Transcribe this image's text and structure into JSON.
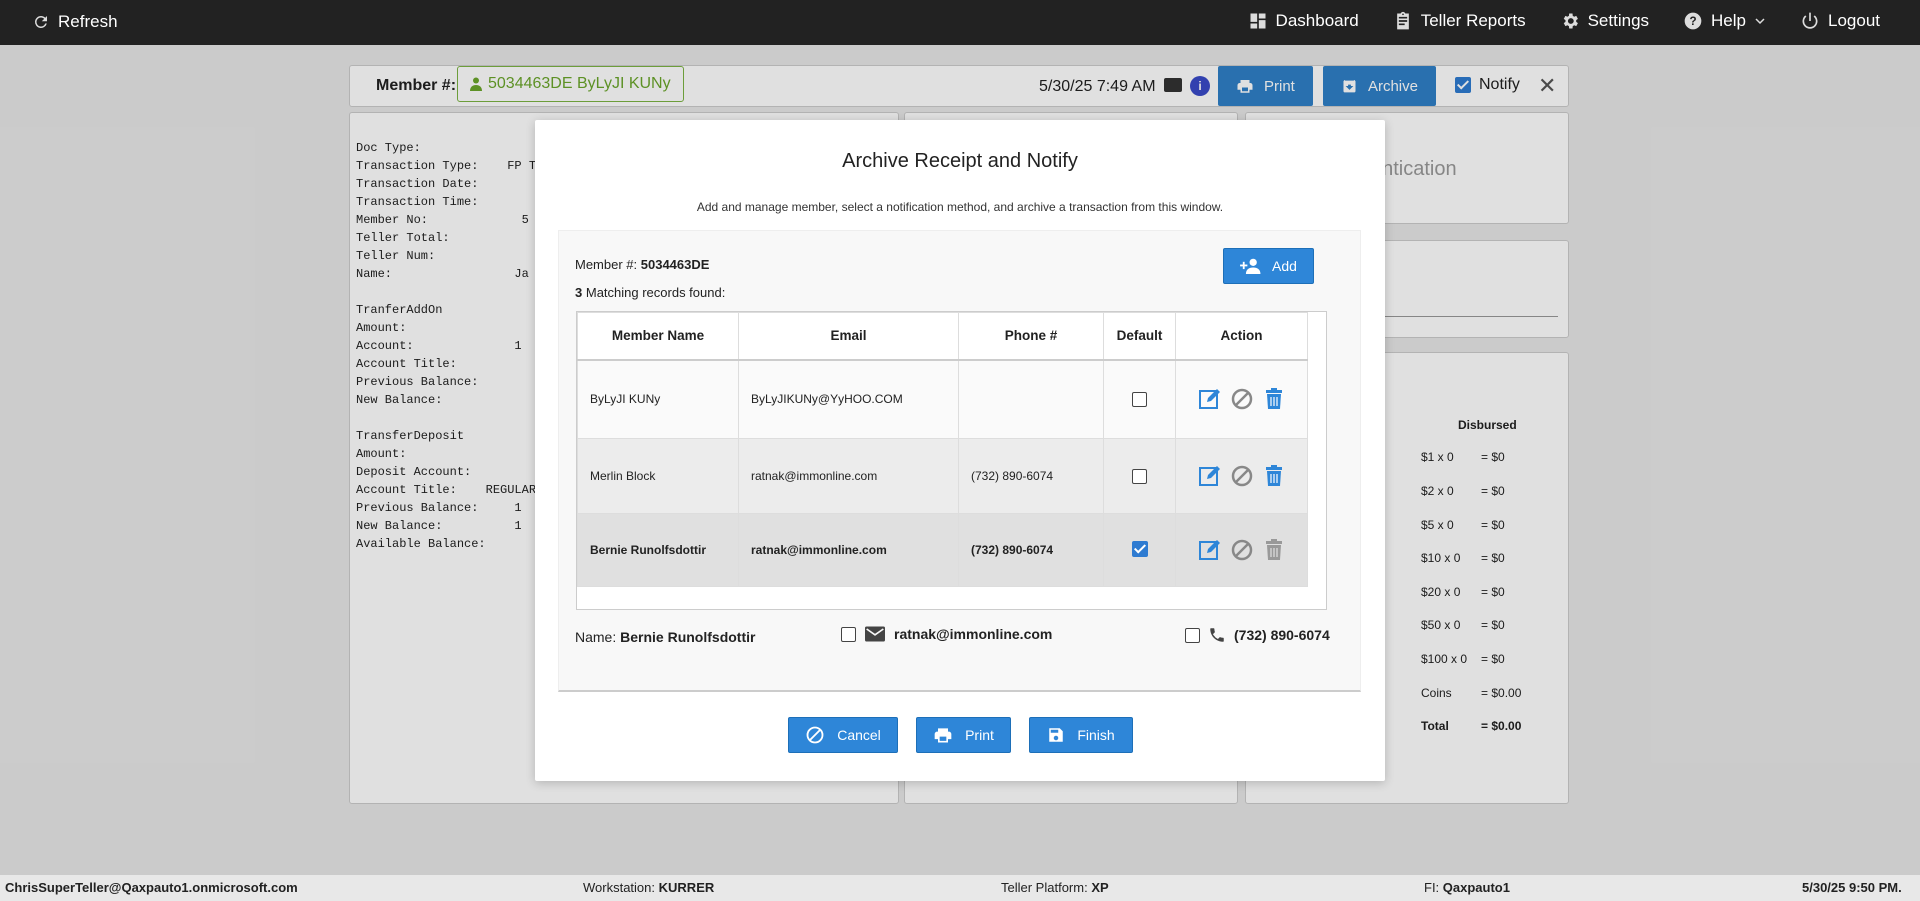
{
  "topbar": {
    "refresh": "Refresh",
    "dashboard": "Dashboard",
    "teller_reports": "Teller Reports",
    "settings": "Settings",
    "help": "Help",
    "logout": "Logout"
  },
  "header": {
    "member_label": "Member #:",
    "member_value": "5034463DE ByLyJI KUNy",
    "datetime": "5/30/25 7:49 AM",
    "print": "Print",
    "archive": "Archive",
    "notify": "Notify"
  },
  "receipt_text": "Doc Type:\nTransaction Type:    FP TRA\nTransaction Date:\nTransaction Time:\nMember No:             5\nTeller Total:\nTeller Num:\nName:                 Ja\n\nTranferAddOn\nAmount:\nAccount:              1\nAccount Title:\nPrevious Balance:\nNew Balance:\n\nTransferDeposit\nAmount:\nDeposit Account:\nAccount Title:    REGULAR\nPrevious Balance:     1\nNew Balance:          1\nAvailable Balance:",
  "right_panel": {
    "title": "entication",
    "disbursed_label": "Disbursed",
    "rows": [
      {
        "label": "$1 x 0",
        "value": "= $0"
      },
      {
        "label": "$2 x 0",
        "value": "= $0"
      },
      {
        "label": "$5 x 0",
        "value": "= $0"
      },
      {
        "label": "$10 x 0",
        "value": "= $0"
      },
      {
        "label": "$20 x 0",
        "value": "= $0"
      },
      {
        "label": "$50 x 0",
        "value": "= $0"
      },
      {
        "label": "$100 x 0",
        "value": "= $0"
      },
      {
        "label": "Coins",
        "value": "= $0.00"
      },
      {
        "label": "Total",
        "value": "= $0.00"
      }
    ]
  },
  "modal": {
    "title": "Archive Receipt and Notify",
    "subtitle": "Add and manage member, select a notification method, and archive a transaction from this window.",
    "member_label": "Member #:",
    "member_value": "5034463DE",
    "match_count": "3",
    "match_text": "Matching records found:",
    "add": "Add",
    "columns": [
      "Member Name",
      "Email",
      "Phone #",
      "Default",
      "Action"
    ],
    "rows": [
      {
        "name": "ByLyJI KUNy",
        "email": "ByLyJIKUNy@YyHOO.COM",
        "phone": "",
        "default": false
      },
      {
        "name": "Merlin Block",
        "email": "ratnak@immonline.com",
        "phone": "(732) 890-6074",
        "default": false
      },
      {
        "name": "Bernie Runolfsdottir",
        "email": "ratnak@immonline.com",
        "phone": "(732) 890-6074",
        "default": true
      }
    ],
    "selected": {
      "name_label": "Name:",
      "name": "Bernie Runolfsdottir",
      "email": "ratnak@immonline.com",
      "phone": "(732) 890-6074"
    },
    "cancel": "Cancel",
    "print": "Print",
    "finish": "Finish"
  },
  "footer": {
    "user": "ChrisSuperTeller@Qaxpauto1.onmicrosoft.com",
    "workstation_label": "Workstation:",
    "workstation": "KURRER",
    "platform_label": "Teller Platform:",
    "platform": "XP",
    "fi_label": "FI:",
    "fi": "Qaxpauto1",
    "datetime": "5/30/25 9:50 PM."
  },
  "colors": {
    "accent": "#2e86d8",
    "topbar": "#222222",
    "member_pill": "#6aa62b"
  }
}
